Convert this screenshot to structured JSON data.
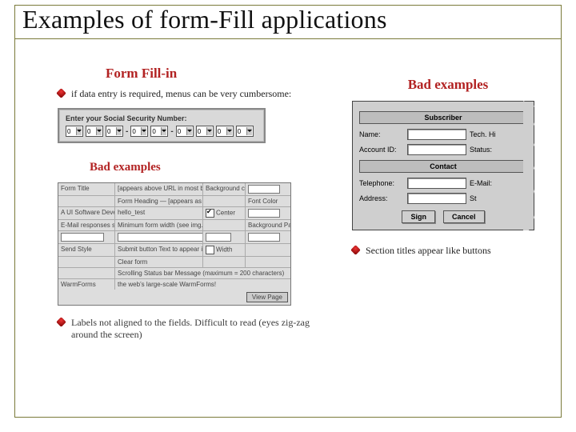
{
  "title": "Examples of form-Fill applications",
  "left": {
    "heading": "Form Fill-in",
    "bullet1": "if data entry is required, menus can be very cumbersome:",
    "ssn": {
      "label": "Enter your Social Security Number:",
      "digits": [
        "0",
        "0",
        "0",
        "0",
        "0",
        "0",
        "0",
        "0",
        "0"
      ]
    },
    "subheading": "Bad examples",
    "table": {
      "rows": [
        {
          "c1": "Form Title",
          "c2": "[appears above URL in most browsers and is used by WWW services]",
          "c3": "Background color",
          "c4": ""
        },
        {
          "c1": "",
          "c2": "Form Heading — [appears as largest text page on the page]",
          "c3": "",
          "c4": "Font Color"
        },
        {
          "c1": "A UI Software Development",
          "c2": "hello_test",
          "c3": "Center",
          "c4": ""
        },
        {
          "c1": "E-Mail responses should appear in",
          "c2": "Minimum form width (see img.)",
          "c3": "",
          "c4": "Background Pattern"
        },
        {
          "c1": "",
          "c2": "",
          "c3": "",
          "c4": ""
        },
        {
          "c1": "Send Style",
          "c2": "Submit button    Text to appear in Reset button",
          "c3": "Width",
          "c4": ""
        },
        {
          "c1": "",
          "c2": "Clear form",
          "c3": "",
          "c4": ""
        },
        {
          "c1": "",
          "c2": "Scrolling Status bar Message (maximum = 200 characters)",
          "c3": "",
          "c4": ""
        },
        {
          "c1": "WarmForms",
          "c2": "the web’s large-scale WarmForms!",
          "c3": "",
          "c4": ""
        }
      ],
      "checkLabel": "Center",
      "widthLabel": "Width",
      "button": "View Page"
    },
    "bullet2": "Labels not aligned to the fields. Difficult to read (eyes zig-zag around the screen)"
  },
  "right": {
    "heading": "Bad examples",
    "card": {
      "band1": "Subscriber",
      "rows1": [
        {
          "label": "Name:",
          "hint": "Tech. Hi"
        },
        {
          "label": "Account ID:",
          "hint": "Status:"
        }
      ],
      "band2": "Contact",
      "rows2": [
        {
          "label": "Telephone:",
          "hint": "E-Mail:"
        },
        {
          "label": "Address:",
          "hint": "St"
        }
      ],
      "btnOk": "Sign",
      "btnCancel": "Cancel"
    },
    "bullet": "Section titles appear like buttons"
  }
}
